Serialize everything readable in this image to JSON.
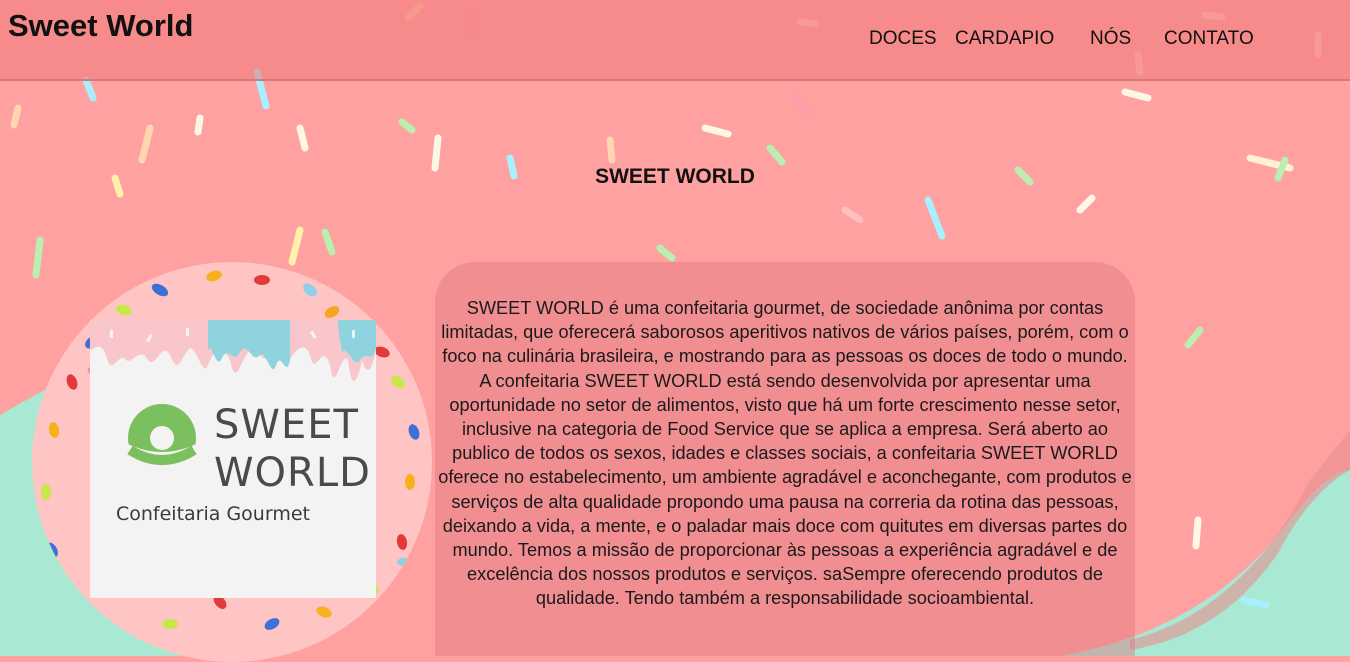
{
  "header": {
    "brand": "Sweet World",
    "nav": [
      {
        "label": "DOCES"
      },
      {
        "label": "CARDAPIO"
      },
      {
        "label": "NÓS"
      },
      {
        "label": "CONTATO"
      }
    ]
  },
  "main": {
    "title": "SWEET WORLD",
    "about_text": "SWEET WORLD é uma confeitaria gourmet, de sociedade anônima por contas limitadas, que oferecerá saborosos aperitivos nativos de vários países, porém, com o foco na culinária brasileira, e mostrando para as pessoas os doces de todo o mundo. A confeitaria SWEET WORLD está sendo desenvolvida por apresentar uma oportunidade no setor de alimentos, visto que há um forte crescimento nesse setor, inclusive na categoria de Food Service que se aplica a empresa. Será aberto ao publico de todos os sexos, idades e classes sociais, a confeitaria SWEET WORLD oferece no estabelecimento, um ambiente agradável e aconchegante, com produtos e serviços de alta qualidade propondo uma pausa na correria da rotina das pessoas, deixando a vida, a mente, e o paladar mais doce com quitutes em diversas partes do mundo. Temos a missão de proporcionar às pessoas a experiência agradável e de excelência dos nossos produtos e serviços. saSempre oferecendo produtos de qualidade. Tendo também a responsabilidade socioambiental."
  },
  "logo": {
    "line1": "SWEET",
    "line2": "WORLD",
    "tagline": "Confeitaria Gourmet",
    "icon": "donut-icon"
  },
  "colors": {
    "background_pink": "#ffa1a1",
    "mint": "#a9e8d2",
    "header": "#f28a88",
    "donut_green": "#7bbf5e",
    "icing_blue": "#8fd3df"
  }
}
